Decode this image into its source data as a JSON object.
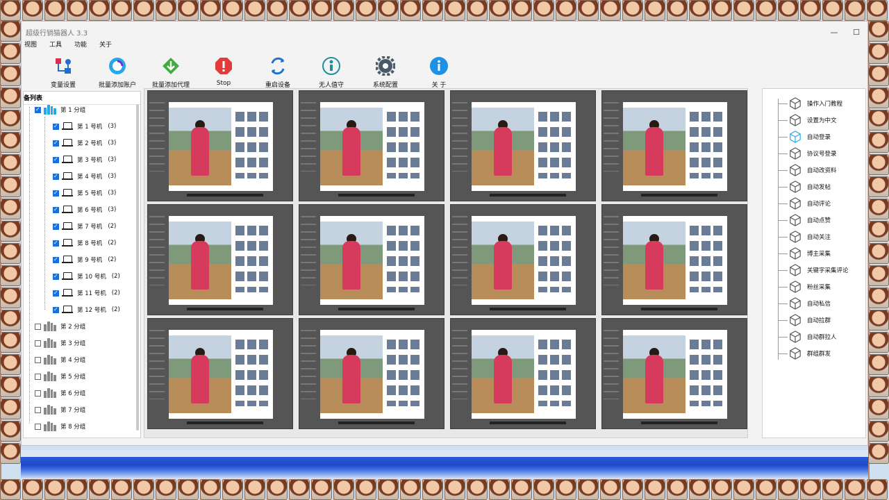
{
  "window": {
    "title": "超级行销猫器人 3.3"
  },
  "menu": [
    "视图",
    "工具",
    "功能",
    "关于"
  ],
  "toolbar": [
    {
      "label": "变量设置",
      "icon": "variables-icon"
    },
    {
      "label": "批量添加账户",
      "icon": "add-account-icon"
    },
    {
      "label": "批量添加代理",
      "icon": "download-proxy-icon"
    },
    {
      "label": "Stop",
      "icon": "stop-icon"
    },
    {
      "label": "重启设备",
      "icon": "restart-icon"
    },
    {
      "label": "无人值守",
      "icon": "unattended-icon"
    },
    {
      "label": "系统配置",
      "icon": "gear-icon"
    },
    {
      "label": "关 于",
      "icon": "info-icon"
    }
  ],
  "device_panel": {
    "title": "备列表",
    "groups": [
      {
        "label": "第 1 分组",
        "checked": true,
        "expanded": true,
        "devices": [
          {
            "label": "第 1 号机",
            "count": "(3)"
          },
          {
            "label": "第 2 号机",
            "count": "(3)"
          },
          {
            "label": "第 3 号机",
            "count": "(3)"
          },
          {
            "label": "第 4 号机",
            "count": "(3)"
          },
          {
            "label": "第 5 号机",
            "count": "(3)"
          },
          {
            "label": "第 6 号机",
            "count": "(3)"
          },
          {
            "label": "第 7 号机",
            "count": "(2)"
          },
          {
            "label": "第 8 号机",
            "count": "(2)"
          },
          {
            "label": "第 9 号机",
            "count": "(2)"
          },
          {
            "label": "第 10 号机",
            "count": "(2)"
          },
          {
            "label": "第 11 号机",
            "count": "(2)"
          },
          {
            "label": "第 12 号机",
            "count": "(2)"
          }
        ]
      },
      {
        "label": "第 2 分组",
        "checked": false
      },
      {
        "label": "第 3 分组",
        "checked": false
      },
      {
        "label": "第 4 分组",
        "checked": false
      },
      {
        "label": "第 5 分组",
        "checked": false
      },
      {
        "label": "第 6 分组",
        "checked": false
      },
      {
        "label": "第 7 分组",
        "checked": false
      },
      {
        "label": "第 8 分组",
        "checked": false
      }
    ]
  },
  "functions": [
    {
      "label": "操作入门教程"
    },
    {
      "label": "设置为中文"
    },
    {
      "label": "自动登录",
      "active": true
    },
    {
      "label": "协议号登录"
    },
    {
      "label": "自动改资料"
    },
    {
      "label": "自动发帖"
    },
    {
      "label": "自动评论"
    },
    {
      "label": "自动点赞"
    },
    {
      "label": "自动关注"
    },
    {
      "label": "博主采集"
    },
    {
      "label": "关键字采集评论"
    },
    {
      "label": "粉丝采集"
    },
    {
      "label": "自动私信"
    },
    {
      "label": "自动拉群"
    },
    {
      "label": "自动群拉人"
    },
    {
      "label": "群组群发"
    }
  ],
  "screens": {
    "rows": 3,
    "cols": 4
  },
  "colors": {
    "accent": "#1a6fd8",
    "active_cube": "#27a8e6"
  }
}
